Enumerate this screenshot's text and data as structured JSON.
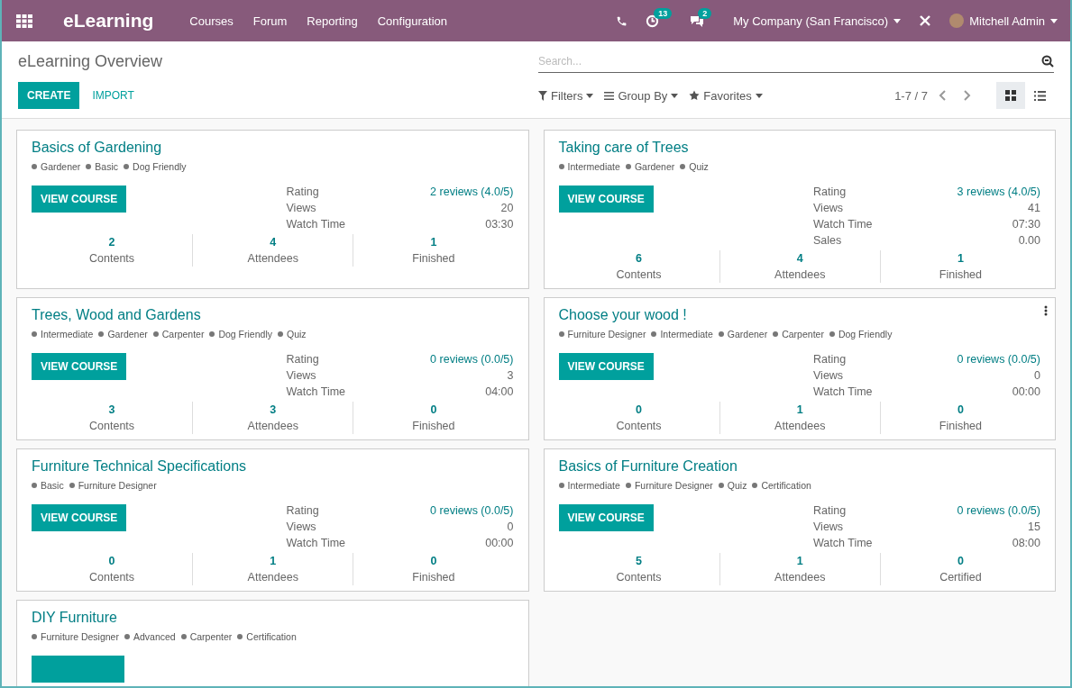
{
  "navbar": {
    "app_name": "eLearning",
    "menu": [
      "Courses",
      "Forum",
      "Reporting",
      "Configuration"
    ],
    "activity_count": "13",
    "message_count": "2",
    "company": "My Company (San Francisco)",
    "user": "Mitchell Admin"
  },
  "control_panel": {
    "title": "eLearning Overview",
    "create": "CREATE",
    "import": "IMPORT",
    "search": {
      "placeholder": "Search..."
    },
    "filters": [
      "Filters",
      "Group By",
      "Favorites"
    ],
    "pager": "1-7 / 7",
    "views": [
      {
        "kind": "kanban",
        "selected": true
      },
      {
        "kind": "list",
        "selected": false
      }
    ]
  },
  "courses": [
    {
      "kind": "full",
      "title": "Basics of Gardening",
      "tags": [
        "Gardener",
        "Basic",
        "Dog Friendly"
      ],
      "button": "VIEW COURSE",
      "menu": false,
      "info": [
        {
          "label": "Rating",
          "value": "2  reviews (4.0/5)",
          "link": true
        },
        {
          "label": "Views",
          "value": "20",
          "link": false
        },
        {
          "label": "Watch Time",
          "value": "03:30",
          "link": false
        }
      ],
      "stats": [
        {
          "value": "2",
          "label": "Contents"
        },
        {
          "value": "4",
          "label": "Attendees"
        },
        {
          "value": "1",
          "label": "Finished"
        }
      ]
    },
    {
      "kind": "full",
      "title": "Taking care of Trees",
      "tags": [
        "Intermediate",
        "Gardener",
        "Quiz"
      ],
      "button": "VIEW COURSE",
      "menu": false,
      "info": [
        {
          "label": "Rating",
          "value": "3  reviews (4.0/5)",
          "link": true
        },
        {
          "label": "Views",
          "value": "41",
          "link": false
        },
        {
          "label": "Watch Time",
          "value": "07:30",
          "link": false
        },
        {
          "label": "Sales",
          "value": "0.00",
          "link": false
        }
      ],
      "stats": [
        {
          "value": "6",
          "label": "Contents"
        },
        {
          "value": "4",
          "label": "Attendees"
        },
        {
          "value": "1",
          "label": "Finished"
        }
      ]
    },
    {
      "kind": "full",
      "title": "Trees, Wood and Gardens",
      "tags": [
        "Intermediate",
        "Gardener",
        "Carpenter",
        "Dog Friendly",
        "Quiz"
      ],
      "button": "VIEW COURSE",
      "menu": false,
      "info": [
        {
          "label": "Rating",
          "value": "0  reviews (0.0/5)",
          "link": true
        },
        {
          "label": "Views",
          "value": "3",
          "link": false
        },
        {
          "label": "Watch Time",
          "value": "04:00",
          "link": false
        }
      ],
      "stats": [
        {
          "value": "3",
          "label": "Contents"
        },
        {
          "value": "3",
          "label": "Attendees"
        },
        {
          "value": "0",
          "label": "Finished"
        }
      ]
    },
    {
      "kind": "full",
      "title": "Choose your wood !",
      "tags": [
        "Furniture Designer",
        "Intermediate",
        "Gardener",
        "Carpenter",
        "Dog Friendly"
      ],
      "button": "VIEW COURSE",
      "menu": true,
      "info": [
        {
          "label": "Rating",
          "value": "0  reviews (0.0/5)",
          "link": true
        },
        {
          "label": "Views",
          "value": "0",
          "link": false
        },
        {
          "label": "Watch Time",
          "value": "00:00",
          "link": false
        }
      ],
      "stats": [
        {
          "value": "0",
          "label": "Contents"
        },
        {
          "value": "1",
          "label": "Attendees"
        },
        {
          "value": "0",
          "label": "Finished"
        }
      ]
    },
    {
      "kind": "full",
      "title": "Furniture Technical Specifications",
      "tags": [
        "Basic",
        "Furniture Designer"
      ],
      "button": "VIEW COURSE",
      "menu": false,
      "info": [
        {
          "label": "Rating",
          "value": "0  reviews (0.0/5)",
          "link": true
        },
        {
          "label": "Views",
          "value": "0",
          "link": false
        },
        {
          "label": "Watch Time",
          "value": "00:00",
          "link": false
        }
      ],
      "stats": [
        {
          "value": "0",
          "label": "Contents"
        },
        {
          "value": "1",
          "label": "Attendees"
        },
        {
          "value": "0",
          "label": "Finished"
        }
      ]
    },
    {
      "kind": "full",
      "title": "Basics of Furniture Creation",
      "tags": [
        "Intermediate",
        "Furniture Designer",
        "Quiz",
        "Certification"
      ],
      "button": "VIEW COURSE",
      "menu": false,
      "info": [
        {
          "label": "Rating",
          "value": "0  reviews (0.0/5)",
          "link": true
        },
        {
          "label": "Views",
          "value": "15",
          "link": false
        },
        {
          "label": "Watch Time",
          "value": "08:00",
          "link": false
        }
      ],
      "stats": [
        {
          "value": "5",
          "label": "Contents"
        },
        {
          "value": "1",
          "label": "Attendees"
        },
        {
          "value": "0",
          "label": "Certified"
        }
      ]
    },
    {
      "kind": "partial",
      "title": "DIY Furniture",
      "tags": [
        "Furniture Designer",
        "Advanced",
        "Carpenter",
        "Certification"
      ],
      "menu": false
    }
  ]
}
